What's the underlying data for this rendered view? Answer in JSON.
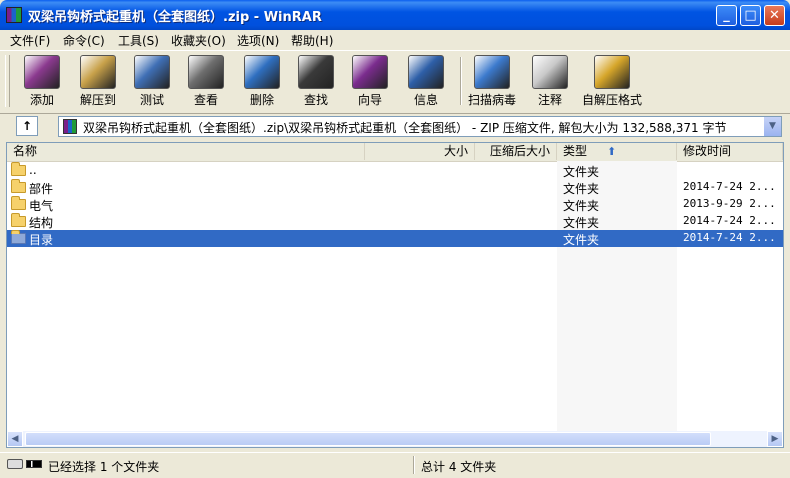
{
  "window": {
    "title": "双梁吊钩桥式起重机（全套图纸）.zip - WinRAR",
    "controls": {
      "minimize": "_",
      "maximize": "□",
      "close": "✕"
    }
  },
  "menu": [
    "文件(F)",
    "命令(C)",
    "工具(S)",
    "收藏夹(O)",
    "选项(N)",
    "帮助(H)"
  ],
  "toolbar": [
    {
      "label": "添加",
      "icon": "add-archive-icon",
      "color": "#8B3A8F"
    },
    {
      "label": "解压到",
      "icon": "extract-to-icon",
      "color": "#C8A14A"
    },
    {
      "label": "测试",
      "icon": "test-icon",
      "color": "#3F6FB5"
    },
    {
      "label": "查看",
      "icon": "view-icon",
      "color": "#6E6E6E"
    },
    {
      "label": "删除",
      "icon": "delete-icon",
      "color": "#2F6FC0"
    },
    {
      "label": "查找",
      "icon": "find-icon",
      "color": "#3A3A3A"
    },
    {
      "label": "向导",
      "icon": "wizard-icon",
      "color": "#7B2C8E"
    },
    {
      "label": "信息",
      "icon": "info-icon",
      "color": "#2E5FA8"
    },
    {
      "label": "扫描病毒",
      "icon": "scan-virus-icon",
      "color": "#3C7ACD"
    },
    {
      "label": "注释",
      "icon": "comment-icon",
      "color": "#C9C9C9"
    },
    {
      "label": "自解压格式",
      "icon": "sfx-icon",
      "color": "#D6A62A"
    }
  ],
  "address": {
    "text": "双梁吊钩桥式起重机（全套图纸）.zip\\双梁吊钩桥式起重机（全套图纸） - ZIP 压缩文件, 解包大小为 132,588,371 字节"
  },
  "columns": [
    "名称",
    "大小",
    "压缩后大小",
    "类型",
    "修改时间"
  ],
  "rows": [
    {
      "name": "..",
      "type": "文件夹",
      "date": ""
    },
    {
      "name": "部件",
      "type": "文件夹",
      "date": "2014-7-24 2..."
    },
    {
      "name": "电气",
      "type": "文件夹",
      "date": "2013-9-29 2..."
    },
    {
      "name": "结构",
      "type": "文件夹",
      "date": "2014-7-24 2..."
    },
    {
      "name": "目录",
      "type": "文件夹",
      "date": "2014-7-24 2..."
    }
  ],
  "status": {
    "selected": "已经选择 1 个文件夹",
    "total": "总计 4 文件夹"
  }
}
